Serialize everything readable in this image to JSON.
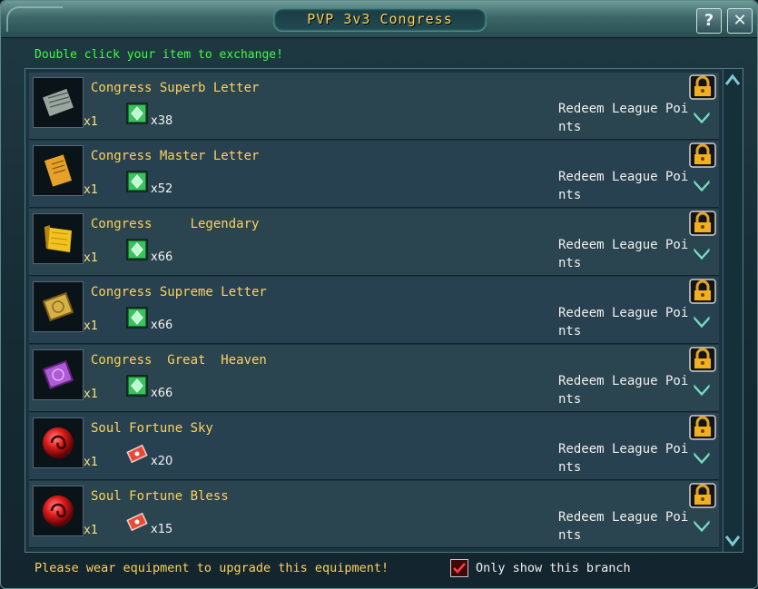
{
  "window": {
    "title": "PVP 3v3 Congress",
    "help_label": "?",
    "close_label": "✕"
  },
  "hint": "Double click your item to exchange!",
  "items": [
    {
      "name": "Congress Superb Letter",
      "qty": "x1",
      "cost": "x38",
      "cost_icon": "green-token-icon",
      "item_icon": "scroll-icon",
      "action": "Redeem League Points"
    },
    {
      "name": "Congress Master Letter",
      "qty": "x1",
      "cost": "x52",
      "cost_icon": "green-token-icon",
      "item_icon": "letter-icon",
      "action": "Redeem League Points"
    },
    {
      "name": "Congress     Legendary",
      "qty": "x1",
      "cost": "x66",
      "cost_icon": "green-token-icon",
      "item_icon": "golden-scroll-icon",
      "action": "Redeem League Points"
    },
    {
      "name": "Congress Supreme Letter",
      "qty": "x1",
      "cost": "x66",
      "cost_icon": "green-token-icon",
      "item_icon": "golden-tablet-icon",
      "action": "Redeem League Points"
    },
    {
      "name": "Congress  Great  Heaven",
      "qty": "x1",
      "cost": "x66",
      "cost_icon": "green-token-icon",
      "item_icon": "purple-tablet-icon",
      "action": "Redeem League Points"
    },
    {
      "name": "Soul Fortune Sky",
      "qty": "x1",
      "cost": "x20",
      "cost_icon": "red-ticket-icon",
      "item_icon": "red-orb-icon",
      "action": "Redeem League Points"
    },
    {
      "name": "Soul Fortune Bless",
      "qty": "x1",
      "cost": "x15",
      "cost_icon": "red-ticket-icon",
      "item_icon": "red-orb-icon",
      "action": "Redeem League Points"
    }
  ],
  "footer": {
    "message": "Please wear equipment to upgrade this equipment!",
    "checkbox_label": "Only show this branch",
    "checkbox_checked": true
  },
  "colors": {
    "title": "#ffd25a",
    "hint": "#3cff3c",
    "item_name": "#ffd25a",
    "text": "#f0f0f0"
  }
}
